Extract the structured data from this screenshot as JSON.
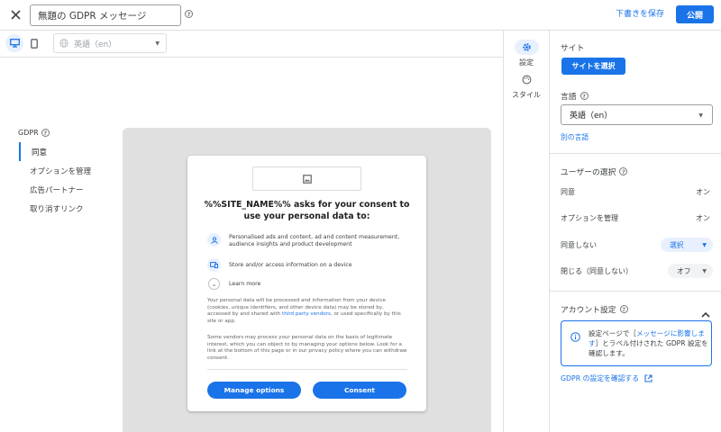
{
  "header": {
    "message_name": "無題の GDPR メッセージ",
    "save_draft": "下書きを保存",
    "publish": "公開"
  },
  "preview_toolbar": {
    "language": "英語（en）"
  },
  "left_nav": {
    "title": "GDPR",
    "items": [
      "同意",
      "オプションを管理",
      "広告パートナー",
      "取り消すリンク"
    ],
    "active_index": 0
  },
  "dialog": {
    "title": "%%SITE_NAME%% asks for your consent to use your personal data to:",
    "purposes": [
      {
        "icon": "person-icon",
        "text": "Personalised ads and content, ad and content measurement, audience insights and product development"
      },
      {
        "icon": "device-icon",
        "text": "Store and/or access information on a device"
      }
    ],
    "learn_more": "Learn more",
    "para1_before": "Your personal data will be processed and information from your device (cookies, unique identifiers, and other device data) may be stored by, accessed by and shared with ",
    "para1_link": "third party vendors",
    "para1_after": ", or used specifically by this site or app.",
    "para2": "Some vendors may process your personal data on the basis of legitimate interest, which you can object to by managing your options below. Look for a link at the bottom of this page or in our privacy policy where you can withdraw consent.",
    "manage_options": "Manage options",
    "consent": "Consent"
  },
  "rail": {
    "settings": "設定",
    "style": "スタイル"
  },
  "settings_panel": {
    "site_heading": "サイト",
    "select_site": "サイトを選択",
    "language_heading": "言語",
    "language_value": "英語（en）",
    "other_language": "別の言語",
    "user_choice_heading": "ユーザーの選択",
    "choices": [
      {
        "label": "同意",
        "value": "オン"
      },
      {
        "label": "オプションを管理",
        "value": "オン"
      },
      {
        "label": "同意しない",
        "value": "選択"
      },
      {
        "label": "閉じる（同意しない）",
        "value": "オフ"
      }
    ],
    "account_heading": "アカウント設定",
    "info_before": "設定ページで［",
    "info_link": "メッセージに影響します",
    "info_after": "］とラベル付けされた GDPR 設定を確認します。",
    "check_link": "GDPR の設定を確認する"
  },
  "colors": {
    "accent": "#1a73e8",
    "preview_bg": "#e0e0e0",
    "pill_blue": "#e8f0fe",
    "pill_gray": "#f1f3f4"
  }
}
